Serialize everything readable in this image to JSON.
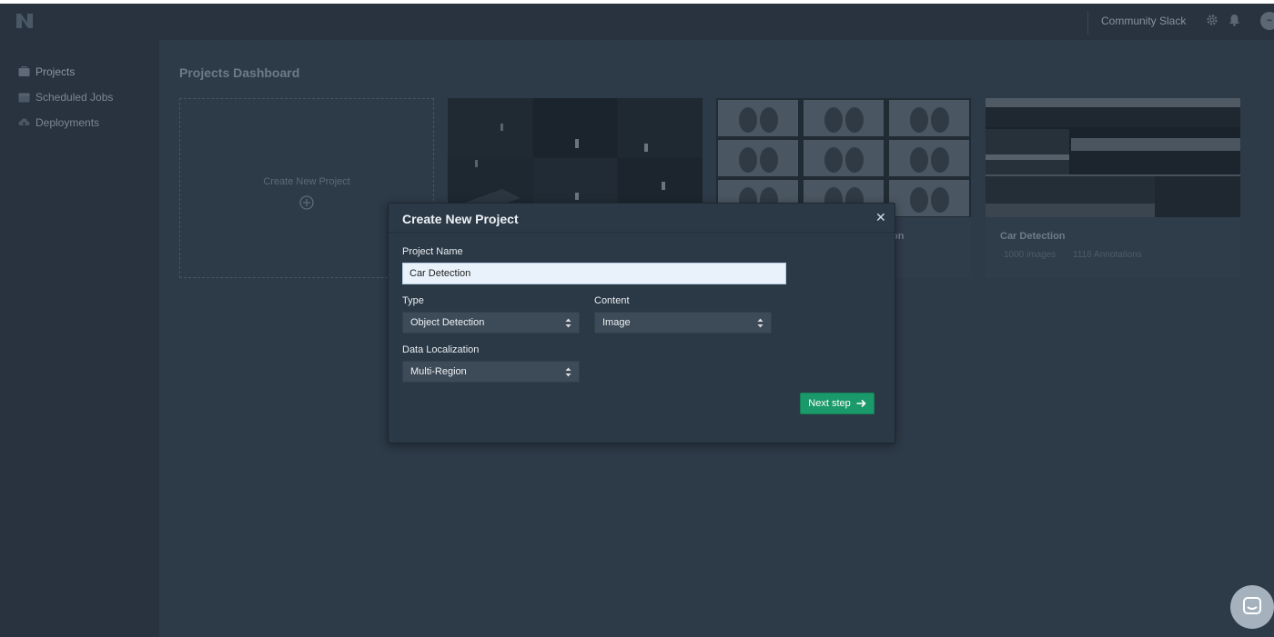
{
  "topbar": {
    "community_label": "Community Slack",
    "avatar_initials": "••"
  },
  "sidebar": {
    "items": [
      {
        "label": "Projects",
        "icon": "folder-icon"
      },
      {
        "label": "Scheduled Jobs",
        "icon": "calendar-icon"
      },
      {
        "label": "Deployments",
        "icon": "cloud-icon"
      }
    ]
  },
  "main": {
    "title": "Projects Dashboard",
    "new_project_label": "Create New Project",
    "projects": [
      {
        "title": "",
        "images": "",
        "annotations": ""
      },
      {
        "title": "on",
        "images": "",
        "annotations": ""
      },
      {
        "title": "Car Detection",
        "images": "1000 images",
        "annotations": "1116 Annotations"
      }
    ]
  },
  "modal": {
    "title": "Create New Project",
    "close_symbol": "✕",
    "project_name_label": "Project Name",
    "project_name_value": "Car Detection",
    "type_label": "Type",
    "type_value": "Object Detection",
    "content_label": "Content",
    "content_value": "Image",
    "localization_label": "Data Localization",
    "localization_value": "Multi-Region",
    "next_button_label": "Next step"
  },
  "colors": {
    "accent_green": "#1a9a6a",
    "modal_bg": "#2b3946",
    "backdrop": "#2d3a47"
  }
}
